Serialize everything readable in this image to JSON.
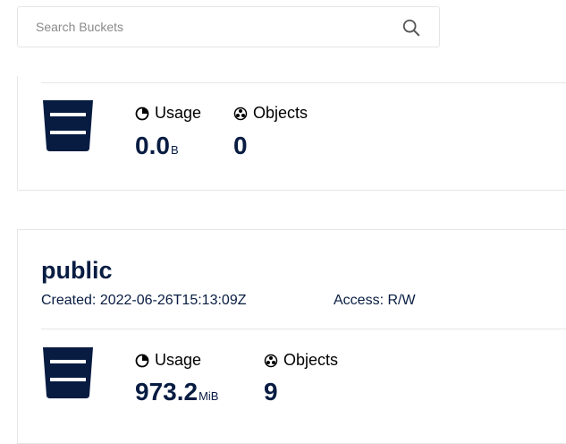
{
  "search": {
    "placeholder": "Search Buckets"
  },
  "buckets": [
    {
      "usage_label": "Usage",
      "usage_value": "0.0",
      "usage_unit": "B",
      "objects_label": "Objects",
      "objects_value": "0"
    },
    {
      "name": "public",
      "created": "Created: 2022-06-26T15:13:09Z",
      "access": "Access: R/W",
      "usage_label": "Usage",
      "usage_value": "973.2",
      "usage_unit": "MiB",
      "objects_label": "Objects",
      "objects_value": "9"
    }
  ],
  "colors": {
    "navy": "#081c42",
    "border": "#e6e6e6"
  },
  "icons": {
    "search": "search-icon",
    "bucket": "bucket-icon",
    "usage": "pie-chart-icon",
    "objects": "objects-icon"
  }
}
